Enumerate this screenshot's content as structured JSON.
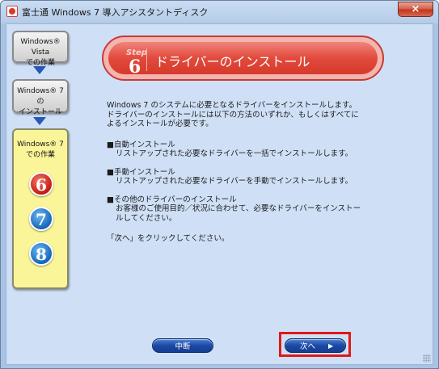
{
  "window": {
    "title": "富士通 Windows 7 導入アシスタントディスク",
    "close_label": "×"
  },
  "steps": {
    "vista": [
      "Windows® Vista",
      "での作業"
    ],
    "win7_install": [
      "Windows® 7 の",
      "インストール"
    ],
    "win7_work": [
      "Windows® 7",
      "での作業"
    ],
    "numbers": [
      "6",
      "7",
      "8"
    ],
    "current": "6"
  },
  "banner": {
    "step_word": "Step",
    "step_number": "6",
    "title": "ドライバーのインストール"
  },
  "content": {
    "intro": [
      "Windows 7 のシステムに必要となるドライバーをインストールします。",
      "ドライバーのインストールには以下の方法のいずれか、もしくはすべてに",
      "よるインストールが必要です。"
    ],
    "items": [
      {
        "head": "■自動インストール",
        "desc": [
          "リストアップされた必要なドライバーを一括でインストールします。"
        ]
      },
      {
        "head": "■手動インストール",
        "desc": [
          "リストアップされた必要なドライバーを手動でインストールします。"
        ]
      },
      {
        "head": "■その他のドライバーのインストール",
        "desc": [
          "お客様のご使用目的／状況に合わせて、必要なドライバーをインストー",
          "ルしてください。"
        ]
      }
    ],
    "outro": "「次へ」をクリックしてください。"
  },
  "buttons": {
    "cancel": "中断",
    "next": "次へ",
    "next_icon": "▶"
  },
  "colors": {
    "banner_red": "#d63a2c",
    "button_blue": "#1c49a4",
    "highlight_red": "#e01818",
    "current_step_yellow": "#fbf59a"
  }
}
